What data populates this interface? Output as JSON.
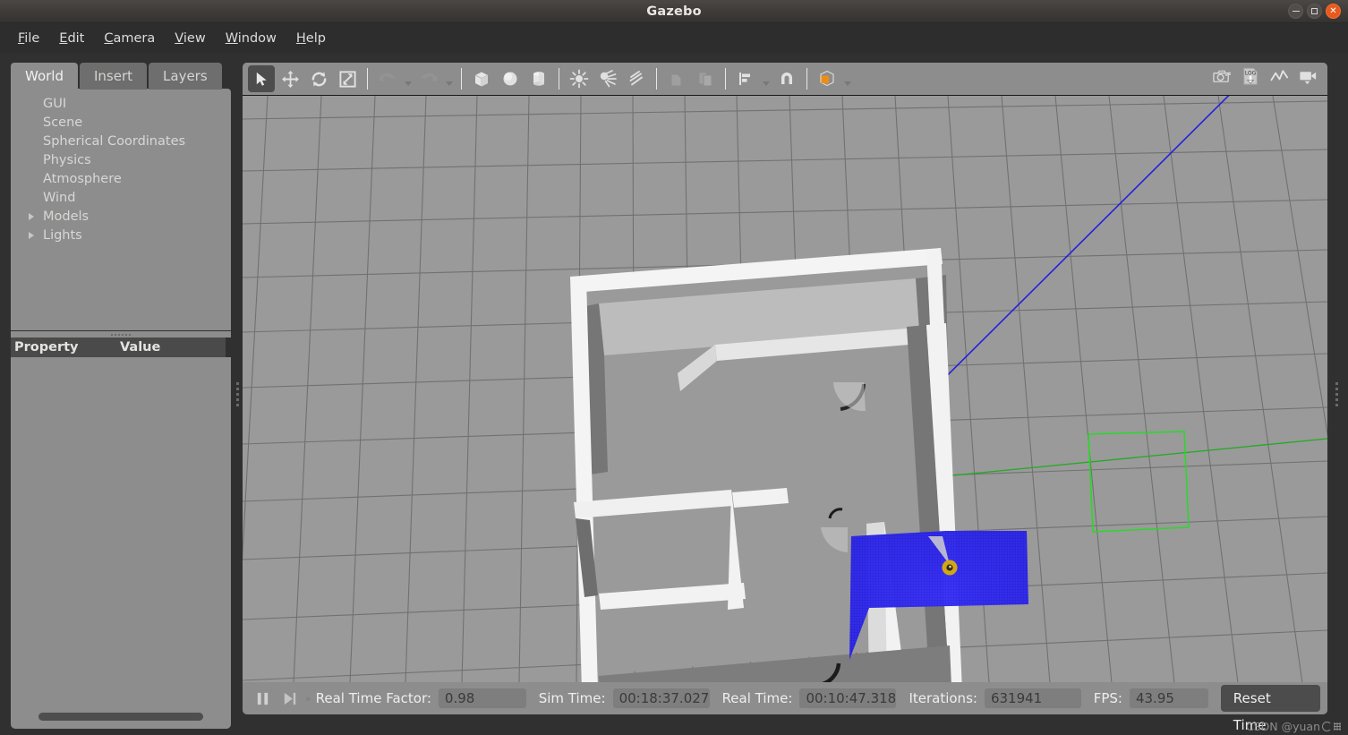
{
  "window": {
    "title": "Gazebo",
    "controls": [
      {
        "name": "minimize-button",
        "glyph": "minimize"
      },
      {
        "name": "maximize-button",
        "glyph": "maximize"
      },
      {
        "name": "close-button",
        "glyph": "close",
        "label": "×"
      }
    ]
  },
  "menubar": {
    "items": [
      {
        "mnemonic": "F",
        "rest": "ile"
      },
      {
        "mnemonic": "E",
        "rest": "dit"
      },
      {
        "mnemonic": "C",
        "rest": "amera"
      },
      {
        "mnemonic": "V",
        "rest": "iew"
      },
      {
        "mnemonic": "W",
        "rest": "indow"
      },
      {
        "mnemonic": "H",
        "rest": "elp"
      }
    ]
  },
  "left_panel": {
    "tabs": [
      {
        "label": "World",
        "active": true
      },
      {
        "label": "Insert",
        "active": false
      },
      {
        "label": "Layers",
        "active": false
      }
    ],
    "tree": [
      {
        "label": "GUI",
        "expandable": false
      },
      {
        "label": "Scene",
        "expandable": false
      },
      {
        "label": "Spherical Coordinates",
        "expandable": false
      },
      {
        "label": "Physics",
        "expandable": false
      },
      {
        "label": "Atmosphere",
        "expandable": false
      },
      {
        "label": "Wind",
        "expandable": false
      },
      {
        "label": "Models",
        "expandable": true
      },
      {
        "label": "Lights",
        "expandable": true
      }
    ],
    "property_table": {
      "columns": [
        "Property",
        "Value"
      ],
      "rows": []
    }
  },
  "toolbar": {
    "left_tools": [
      {
        "name": "select-mode-button",
        "icon": "cursor-arrow-icon",
        "active": true,
        "enabled": true
      },
      {
        "name": "translate-mode-button",
        "icon": "move-arrows-icon",
        "active": false,
        "enabled": true
      },
      {
        "name": "rotate-mode-button",
        "icon": "rotate-arrows-icon",
        "active": false,
        "enabled": true
      },
      {
        "name": "scale-mode-button",
        "icon": "scale-diagonal-icon",
        "active": false,
        "enabled": true
      },
      {
        "name": "undo-button",
        "icon": "undo-arrow-icon",
        "active": false,
        "enabled": false,
        "caret": true
      },
      {
        "name": "redo-button",
        "icon": "redo-arrow-icon",
        "active": false,
        "enabled": false,
        "caret": true
      },
      {
        "name": "insert-box-button",
        "icon": "box-icon",
        "active": false,
        "enabled": true
      },
      {
        "name": "insert-sphere-button",
        "icon": "sphere-icon",
        "active": false,
        "enabled": true
      },
      {
        "name": "insert-cylinder-button",
        "icon": "cylinder-icon",
        "active": false,
        "enabled": true
      },
      {
        "name": "insert-point-light-button",
        "icon": "point-light-icon",
        "active": false,
        "enabled": true
      },
      {
        "name": "insert-spot-light-button",
        "icon": "spot-light-icon",
        "active": false,
        "enabled": true
      },
      {
        "name": "insert-directional-light-button",
        "icon": "directional-light-icon",
        "active": false,
        "enabled": true
      },
      {
        "name": "copy-button",
        "icon": "copy-icon",
        "active": false,
        "enabled": false
      },
      {
        "name": "paste-button",
        "icon": "paste-icon",
        "active": false,
        "enabled": false
      },
      {
        "name": "align-button",
        "icon": "align-icon",
        "active": false,
        "enabled": true,
        "caret": true
      },
      {
        "name": "snap-button",
        "icon": "magnet-snap-icon",
        "active": false,
        "enabled": true
      },
      {
        "name": "view-angle-button",
        "icon": "orange-cube-icon",
        "active": false,
        "enabled": true,
        "caret": true
      }
    ],
    "right_tools": [
      {
        "name": "screenshot-button",
        "icon": "camera-icon"
      },
      {
        "name": "log-record-button",
        "icon": "log-download-icon",
        "label": "LOG"
      },
      {
        "name": "plot-button",
        "icon": "plot-line-icon"
      },
      {
        "name": "video-record-button",
        "icon": "video-camera-icon",
        "caret": true
      }
    ]
  },
  "statusbar": {
    "pause_button": {
      "name": "pause-button",
      "icon": "pause-icon"
    },
    "step_button": {
      "name": "step-button",
      "icon": "step-forward-icon"
    },
    "expander": "»",
    "fields": [
      {
        "name": "real-time-factor",
        "label": "Real Time Factor:",
        "value": "0.98",
        "width_class": "w-rtf"
      },
      {
        "name": "sim-time",
        "label": "Sim Time:",
        "value": "00:18:37.027",
        "width_class": "w-sim"
      },
      {
        "name": "real-time",
        "label": "Real Time:",
        "value": "00:10:47.318",
        "width_class": "w-real"
      },
      {
        "name": "iterations",
        "label": "Iterations:",
        "value": "631941",
        "width_class": "w-iter"
      },
      {
        "name": "fps",
        "label": "FPS:",
        "value": "43.95",
        "width_class": "w-fps"
      }
    ],
    "reset_button": "Reset Time"
  },
  "watermark": {
    "text": "CSDN @yuan"
  },
  "viewport": {
    "name": "gazebo-3d-viewport",
    "background_color": "#9a9a9a",
    "grid_line_color": "#6f6f6f",
    "wall_top_color": "#f2f2f2",
    "wall_side_color": "#b4b4b4",
    "wall_shadow_color": "#5e5e5e",
    "laser_scan_color": "#2b24e8",
    "robot_marker_color": "#d2a613",
    "axis_x_color": "#cc2222",
    "axis_y_color": "#22bb22",
    "axis_z_color": "#2222dd",
    "selection_box_color": "#22dd22",
    "scene_description": "Top-down view of an indoor building floor plan with white walls, a blue 2D laser-scan fan emitted from a yellow robot marker inside the lower-left room, a green selection bounding box on the right, and red/green/blue world axis lines."
  }
}
